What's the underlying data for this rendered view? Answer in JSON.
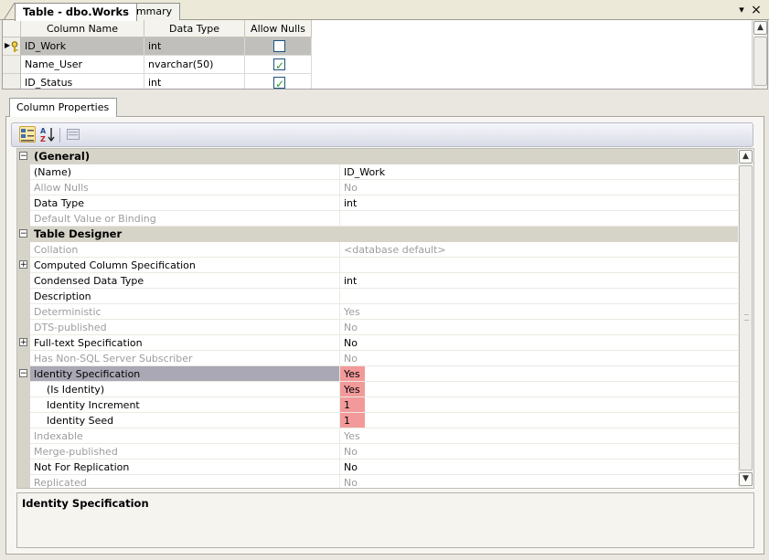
{
  "tabs": [
    {
      "label": "Table - dbo.Works",
      "active": true
    },
    {
      "label": "Summary",
      "active": false
    }
  ],
  "window_controls": {
    "dropdown": "▾",
    "close": "×"
  },
  "grid": {
    "headers": [
      "Column Name",
      "Data Type",
      "Allow Nulls"
    ],
    "rows": [
      {
        "name": "ID_Work",
        "type": "int",
        "allow_nulls": false,
        "selected": true,
        "primary_key": true
      },
      {
        "name": "Name_User",
        "type": "nvarchar(50)",
        "allow_nulls": true,
        "selected": false,
        "primary_key": false
      },
      {
        "name": "ID_Status",
        "type": "int",
        "allow_nulls": true,
        "selected": false,
        "primary_key": false
      }
    ]
  },
  "properties_tab": "Column Properties",
  "toolbar": {
    "categorized": "categorized-icon",
    "alphabetical": "alphabetical-icon",
    "property_pages": "property-pages-icon"
  },
  "properties": [
    {
      "kind": "category",
      "label": "(General)",
      "expander": "−"
    },
    {
      "kind": "prop",
      "name": "(Name)",
      "value": "ID_Work"
    },
    {
      "kind": "prop",
      "name": "Allow Nulls",
      "value": "No",
      "dim": true
    },
    {
      "kind": "prop",
      "name": "Data Type",
      "value": "int"
    },
    {
      "kind": "prop",
      "name": "Default Value or Binding",
      "value": "",
      "dim": true
    },
    {
      "kind": "category",
      "label": "Table Designer",
      "expander": "−"
    },
    {
      "kind": "prop",
      "name": "Collation",
      "value": "<database default>",
      "dim": true
    },
    {
      "kind": "prop",
      "name": "Computed Column Specification",
      "value": "",
      "expander": "+"
    },
    {
      "kind": "prop",
      "name": "Condensed Data Type",
      "value": "int"
    },
    {
      "kind": "prop",
      "name": "Description",
      "value": ""
    },
    {
      "kind": "prop",
      "name": "Deterministic",
      "value": "Yes",
      "dim": true
    },
    {
      "kind": "prop",
      "name": "DTS-published",
      "value": "No",
      "dim": true
    },
    {
      "kind": "prop",
      "name": "Full-text Specification",
      "value": "No",
      "expander": "+"
    },
    {
      "kind": "prop",
      "name": "Has Non-SQL Server Subscriber",
      "value": "No",
      "dim": true
    },
    {
      "kind": "prop",
      "name": "Identity Specification",
      "value": "Yes",
      "expander": "−",
      "selected": true,
      "highlight": true
    },
    {
      "kind": "prop",
      "name": "(Is Identity)",
      "value": "Yes",
      "indent": true,
      "highlight": true
    },
    {
      "kind": "prop",
      "name": "Identity Increment",
      "value": "1",
      "indent": true,
      "highlight": true
    },
    {
      "kind": "prop",
      "name": "Identity Seed",
      "value": "1",
      "indent": true,
      "highlight": true
    },
    {
      "kind": "prop",
      "name": "Indexable",
      "value": "Yes",
      "dim": true
    },
    {
      "kind": "prop",
      "name": "Merge-published",
      "value": "No",
      "dim": true
    },
    {
      "kind": "prop",
      "name": "Not For Replication",
      "value": "No"
    },
    {
      "kind": "prop",
      "name": "Replicated",
      "value": "No",
      "dim": true
    }
  ],
  "description_title": "Identity Specification",
  "colors": {
    "highlight_value": "#f29a9a",
    "selected_row": "#a9a8b4",
    "category_band": "#d6d3c8"
  }
}
